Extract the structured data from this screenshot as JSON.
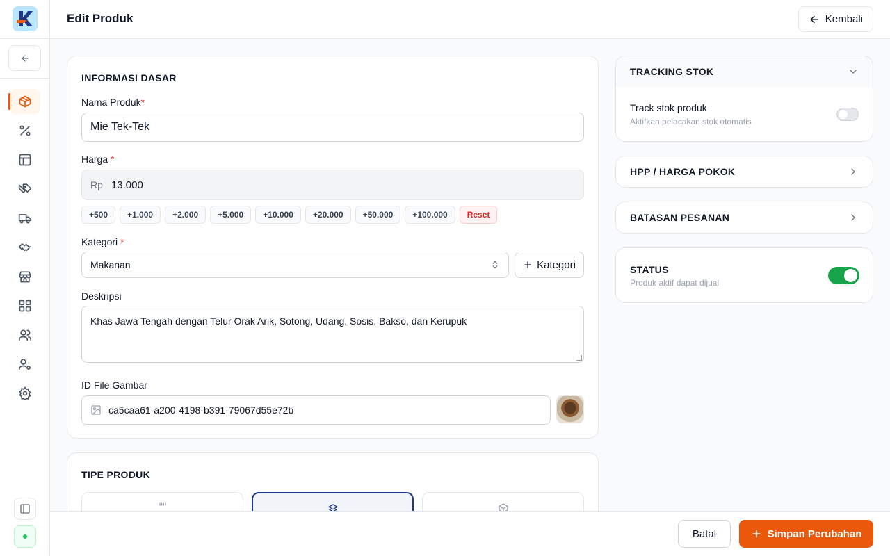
{
  "app": {
    "logo_letter": "K",
    "accent_color": "#ea580c",
    "success_color": "#16a34a"
  },
  "sidebar": {
    "collapse_icon": "arrow-left-icon",
    "items": [
      {
        "id": "products",
        "icon": "package-icon",
        "active": true
      },
      {
        "id": "discounts",
        "icon": "percent-icon",
        "active": false
      },
      {
        "id": "layout",
        "icon": "layout-icon",
        "active": false
      },
      {
        "id": "tags",
        "icon": "tags-icon",
        "active": false
      },
      {
        "id": "delivery",
        "icon": "truck-icon",
        "active": false
      },
      {
        "id": "partners",
        "icon": "handshake-icon",
        "active": false
      },
      {
        "id": "store",
        "icon": "store-icon",
        "active": false
      },
      {
        "id": "apps",
        "icon": "grid-icon",
        "active": false
      },
      {
        "id": "users",
        "icon": "users-icon",
        "active": false
      },
      {
        "id": "user-settings",
        "icon": "user-cog-icon",
        "active": false
      },
      {
        "id": "settings",
        "icon": "gear-icon",
        "active": false
      }
    ],
    "panel_toggle_icon": "sidebar-panel-icon",
    "status_icon": "online-dot-icon"
  },
  "header": {
    "title": "Edit Produk",
    "back_label": "Kembali"
  },
  "basic_info": {
    "section_title": "INFORMASI DASAR",
    "name_label": "Nama Produk",
    "name_value": "Mie Tek-Tek",
    "price_label": "Harga",
    "price_prefix": "Rp",
    "price_value": "13.000",
    "quick_amounts": [
      "+500",
      "+1.000",
      "+2.000",
      "+5.000",
      "+10.000",
      "+20.000",
      "+50.000",
      "+100.000"
    ],
    "reset_label": "Reset",
    "category_label": "Kategori",
    "category_value": "Makanan",
    "add_category_label": "Kategori",
    "description_label": "Deskripsi",
    "description_value": "Khas Jawa Tengah dengan Telur Orak Arik, Sotong, Udang, Sosis, Bakso, dan Kerupuk",
    "image_label": "ID File Gambar",
    "image_value": "ca5caa61-a200-4198-b391-79067d55e72b",
    "required_mark": "*"
  },
  "product_type": {
    "section_title": "TIPE PRODUK",
    "options": [
      {
        "icon": "steam-icon",
        "selected": false
      },
      {
        "icon": "layers-icon",
        "selected": true
      },
      {
        "icon": "box-icon",
        "selected": false
      }
    ]
  },
  "stock_tracking": {
    "title": "TRACKING STOK",
    "row_title": "Track stok produk",
    "row_subtitle": "Aktifkan pelacakan stok otomatis",
    "enabled": false
  },
  "hpp": {
    "title": "HPP / HARGA POKOK"
  },
  "order_limit": {
    "title": "BATASAN PESANAN"
  },
  "status": {
    "title": "STATUS",
    "subtitle": "Produk aktif dapat dijual",
    "enabled": true
  },
  "footer": {
    "cancel_label": "Batal",
    "save_label": "Simpan Perubahan"
  }
}
